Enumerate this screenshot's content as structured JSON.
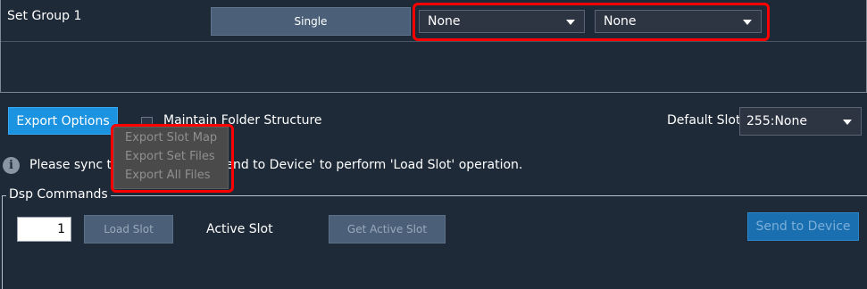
{
  "group": {
    "label": "Set Group 1",
    "mode_button": "Single",
    "dropdown_1": "None",
    "dropdown_2": "None"
  },
  "options": {
    "export_button": "Export Options",
    "maintain_label": "Maintain Folder Structure",
    "maintain_checked": false,
    "default_slot_label": "Default Slot",
    "default_slot_value": "255:None"
  },
  "export_menu": {
    "items": [
      "Export Slot Map",
      "Export Set Files",
      "Export All Files"
    ]
  },
  "info": {
    "icon": "info-icon",
    "text": "Please sync the device using 'Send to Device' to perform 'Load Slot' operation."
  },
  "dsp": {
    "title": "Dsp Commands",
    "slot_value": "1",
    "load_slot": "Load Slot",
    "active_slot_label": "Active Slot",
    "get_active_slot": "Get Active Slot",
    "send_to_device": "Send to Device"
  },
  "colors": {
    "background": "#1e2a38",
    "accent": "#1c93e0",
    "highlight": "#ff0000"
  }
}
